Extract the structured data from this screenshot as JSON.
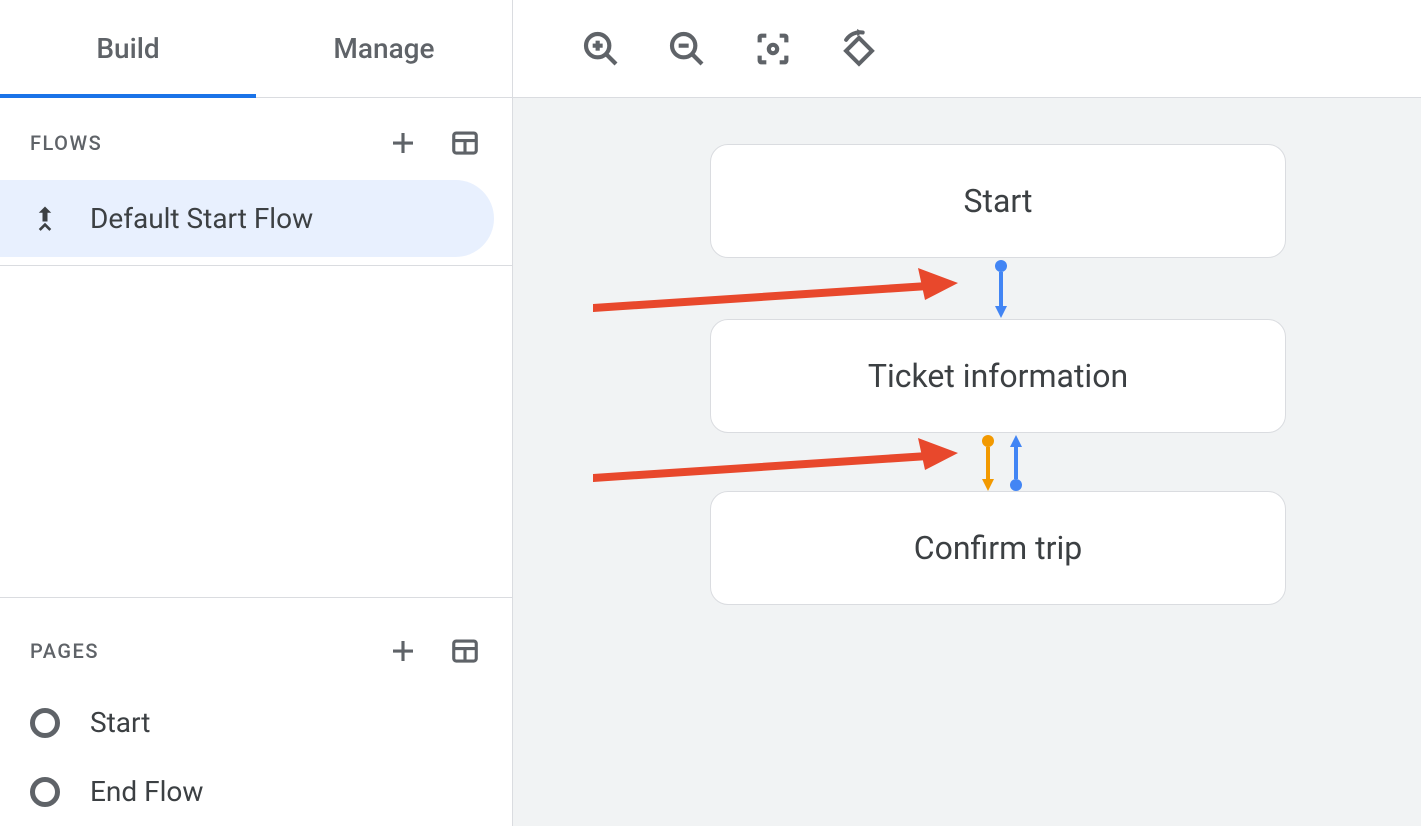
{
  "tabs": {
    "build": "Build",
    "manage": "Manage",
    "active": "build"
  },
  "flows": {
    "header": "FLOWS",
    "items": [
      {
        "label": "Default Start Flow",
        "selected": true
      }
    ]
  },
  "pages": {
    "header": "PAGES",
    "items": [
      {
        "label": "Start"
      },
      {
        "label": "End Flow"
      }
    ]
  },
  "canvas": {
    "nodes": [
      {
        "label": "Start"
      },
      {
        "label": "Ticket information"
      },
      {
        "label": "Confirm trip"
      }
    ]
  }
}
